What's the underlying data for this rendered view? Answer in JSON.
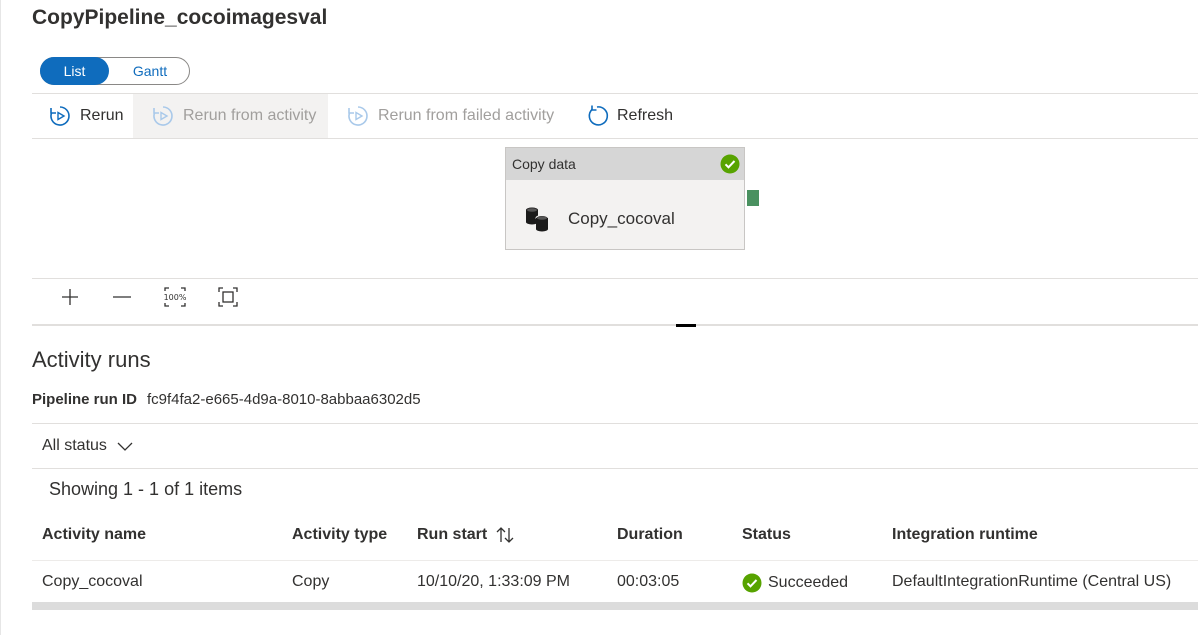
{
  "title": "CopyPipeline_cocoimagesval",
  "view_toggle": {
    "list_label": "List",
    "gantt_label": "Gantt",
    "selected": "List"
  },
  "toolbar": {
    "rerun": "Rerun",
    "rerun_from_activity": "Rerun from activity",
    "rerun_from_failed": "Rerun from failed activity",
    "refresh": "Refresh"
  },
  "canvas": {
    "node": {
      "header": "Copy data",
      "name": "Copy_cocoval",
      "status_icon": "check-circle-icon",
      "icon": "database-icon"
    },
    "zoom_controls": [
      "zoom-in-icon",
      "zoom-out-icon",
      "zoom-100-icon",
      "fit-to-screen-icon"
    ],
    "zoom_100_text": "100%"
  },
  "activity_runs": {
    "title": "Activity runs",
    "run_id_label": "Pipeline run ID",
    "run_id_value": "fc9f4fa2-e665-4d9a-8010-8abbaa6302d5",
    "filter_label": "All status",
    "showing": "Showing 1 - 1 of 1 items",
    "columns": [
      "Activity name",
      "Activity type",
      "Run start",
      "Duration",
      "Status",
      "Integration runtime"
    ],
    "rows": [
      {
        "activity_name": "Copy_cocoval",
        "activity_type": "Copy",
        "run_start": "10/10/20, 1:33:09 PM",
        "duration": "00:03:05",
        "status": "Succeeded",
        "integration_runtime": "DefaultIntegrationRuntime (Central US)"
      }
    ]
  },
  "colors": {
    "accent": "#0f6cbd",
    "success": "#57a300",
    "port": "#4a9160"
  }
}
